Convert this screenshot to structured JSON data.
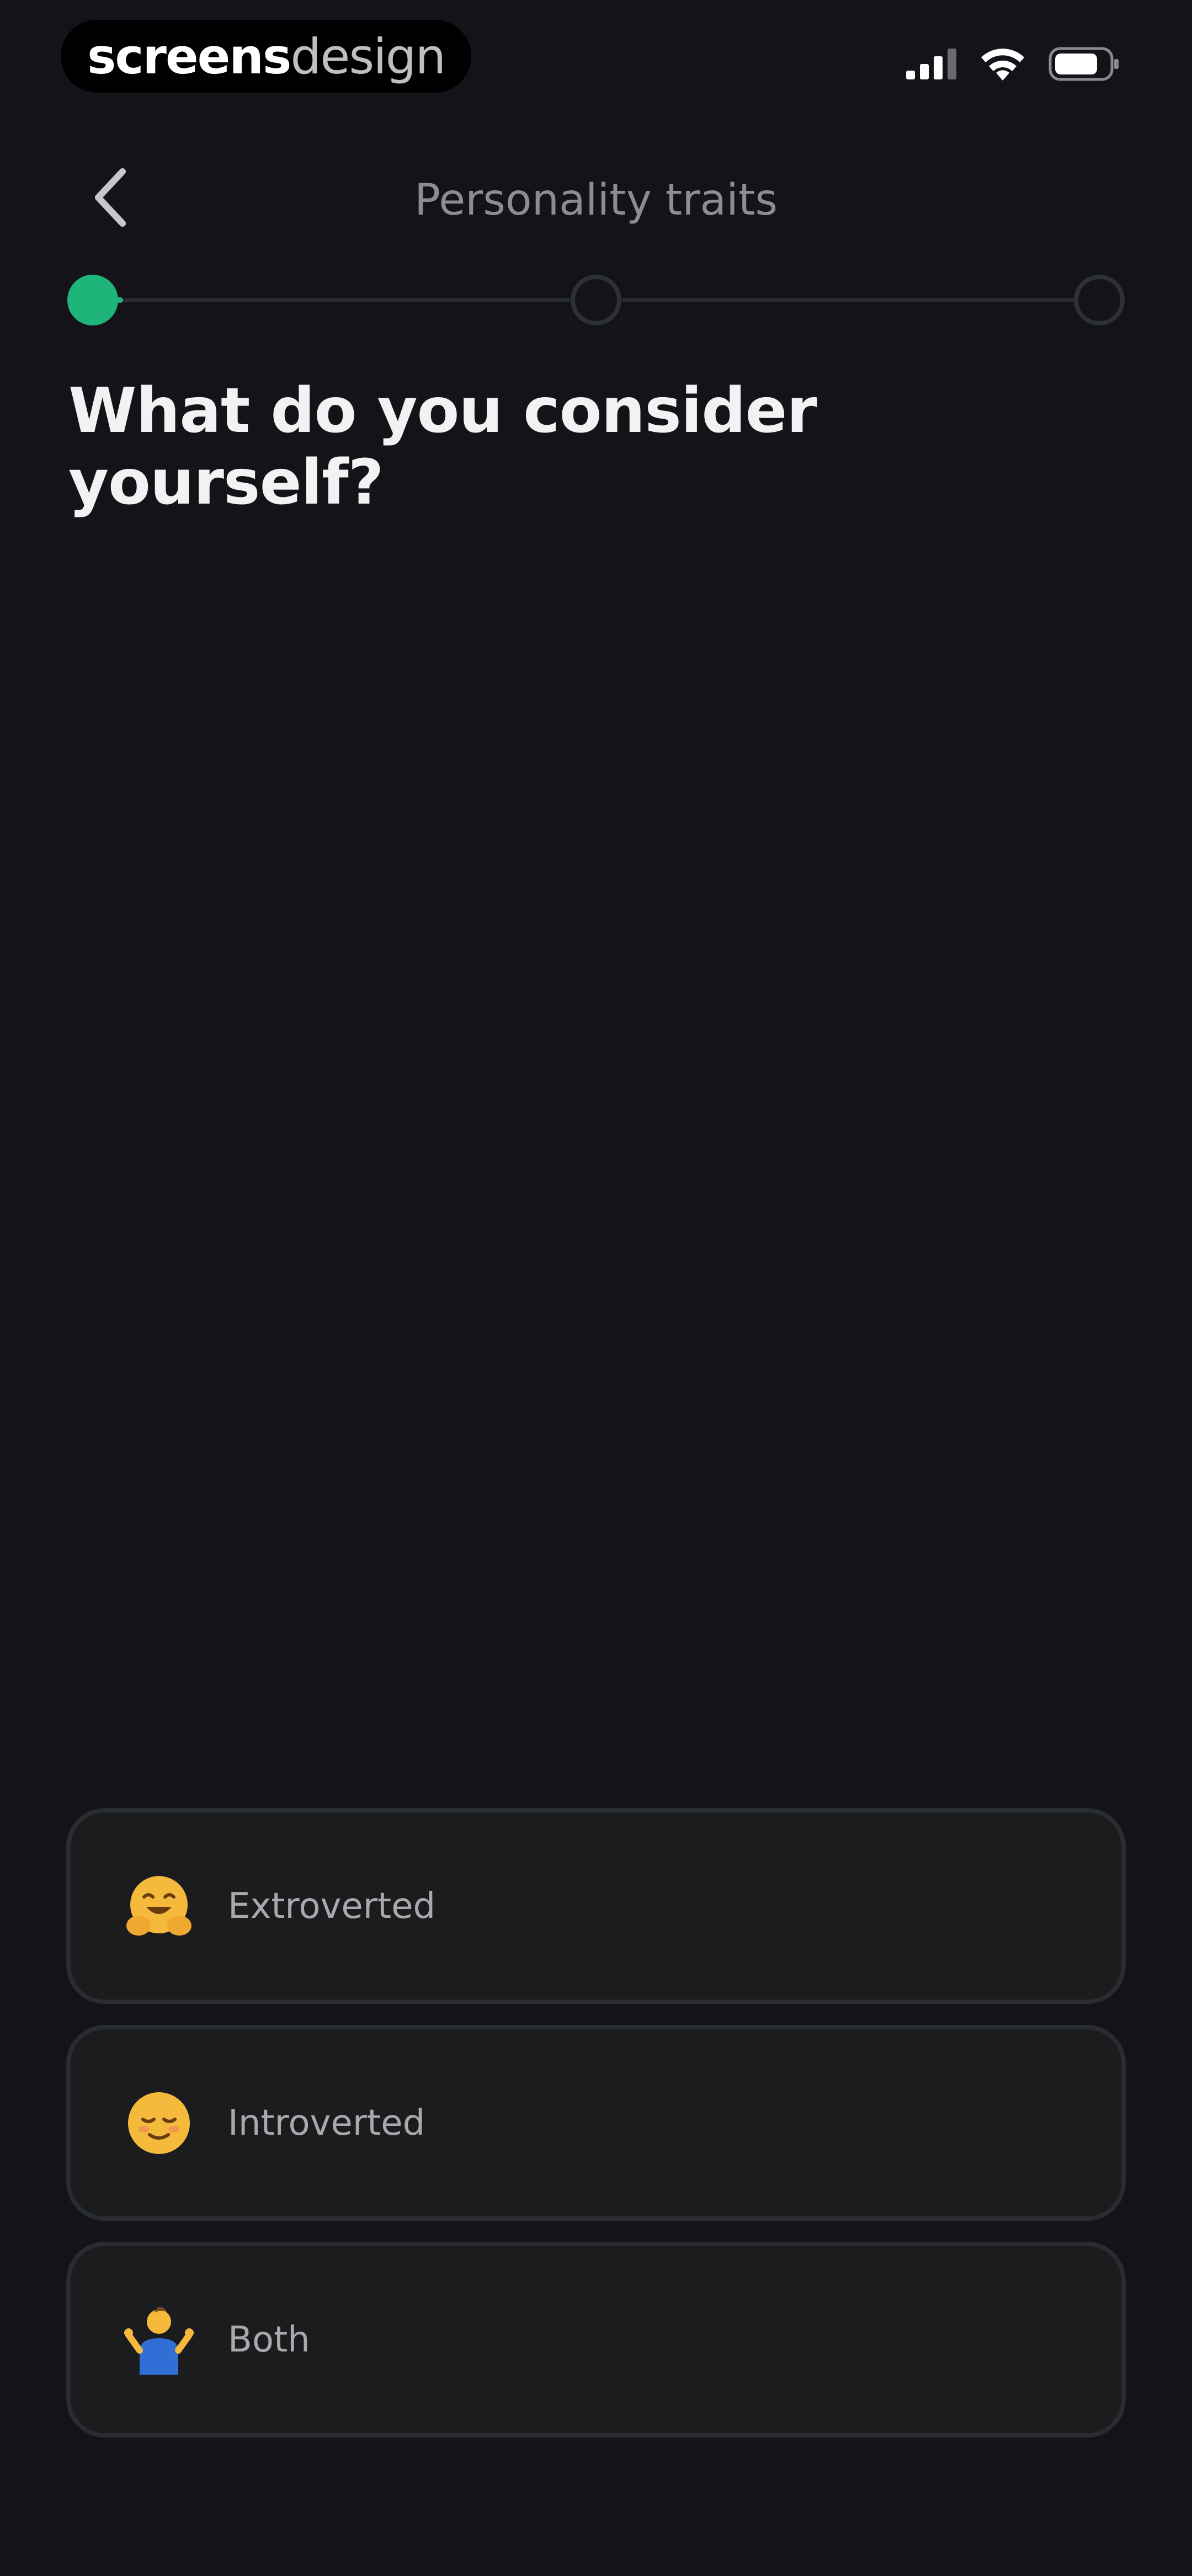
{
  "status_bar": {
    "watermark_bold": "screens",
    "watermark_light": "design",
    "icons": [
      "cellular-signal-icon",
      "wifi-icon",
      "battery-icon"
    ]
  },
  "header": {
    "title": "Personality traits",
    "back_icon": "chevron-left-icon"
  },
  "stepper": {
    "total_steps": 3,
    "current_step": 1,
    "progress": 0.03,
    "accent_color": "#1fb57a"
  },
  "question": "What do you consider yourself?",
  "options": [
    {
      "label": "Extroverted",
      "icon": "hugging-face-emoji-icon"
    },
    {
      "label": "Introverted",
      "icon": "relieved-face-emoji-icon"
    },
    {
      "label": "Both",
      "icon": "person-shrugging-emoji-icon"
    }
  ],
  "colors": {
    "background": "#131319",
    "card": "#1b1c1e",
    "card_border": "#2a2d2f",
    "accent": "#1fb57a"
  }
}
